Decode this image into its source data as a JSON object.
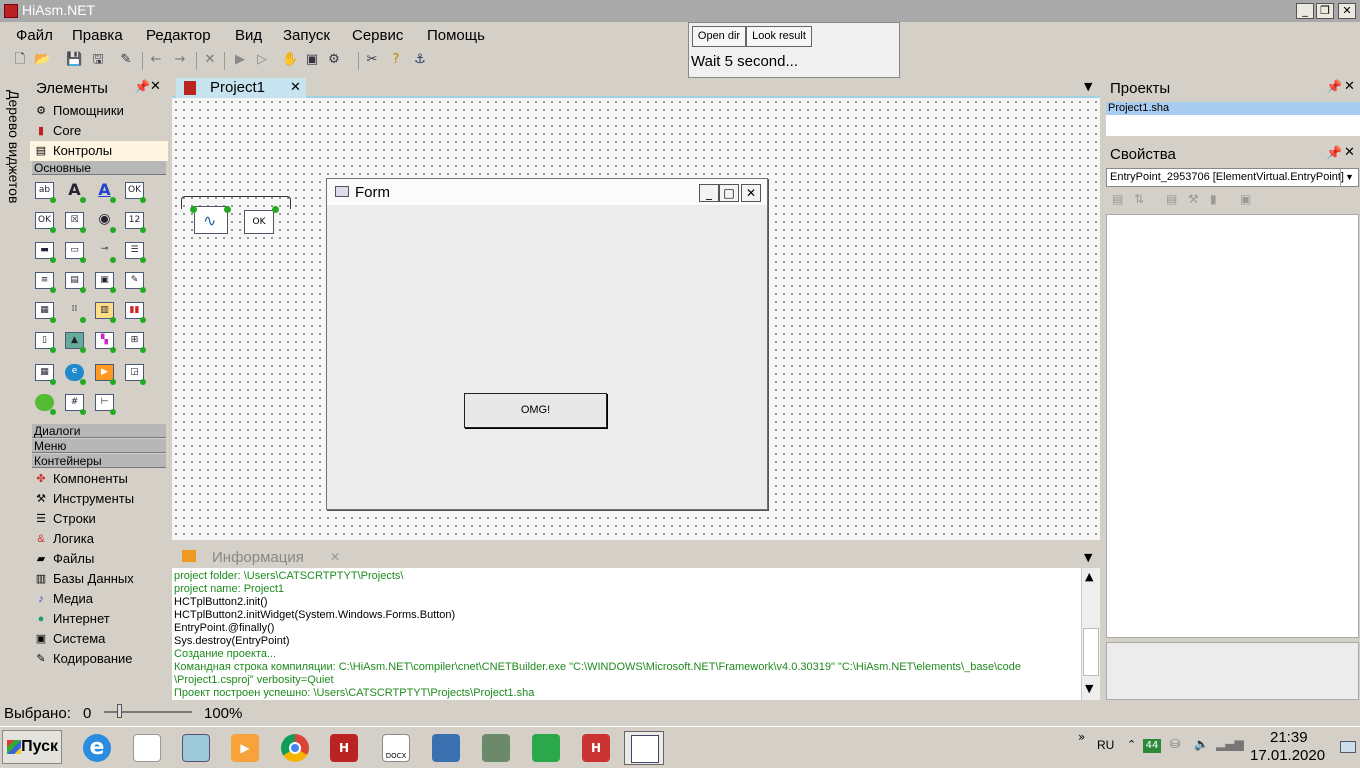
{
  "app": {
    "title": "HiAsm.NET"
  },
  "menu": [
    "Файл",
    "Правка",
    "Редактор",
    "Вид",
    "Запуск",
    "Сервис",
    "Помощь"
  ],
  "wait_panel": {
    "open_dir": "Open dir",
    "look_result": "Look result",
    "message": "Wait 5 second..."
  },
  "left": {
    "vertical_tab": "Дерево виджетов",
    "header": "Элементы",
    "top_groups": [
      "Помощники",
      "Core",
      "Контролы"
    ],
    "section_active": "Основные",
    "collapsed_sections": [
      "Диалоги",
      "Меню",
      "Контейнеры"
    ],
    "groups": [
      "Компоненты",
      "Инструменты",
      "Строки",
      "Логика",
      "Файлы",
      "Базы Данных",
      "Медиа",
      "Интернет",
      "Система",
      "Кодирование"
    ]
  },
  "doc_tab": {
    "label": "Project1"
  },
  "form": {
    "title": "Form",
    "button": "OMG!"
  },
  "info": {
    "tab": "Информация",
    "lines": [
      {
        "text": "project folder: \\Users\\CATSCRTPTYT\\Projects\\",
        "color": "#1e8a1e"
      },
      {
        "text": "project name: Project1",
        "color": "#1e8a1e"
      },
      {
        "text": "HCTplButton2.init()",
        "color": "#000000"
      },
      {
        "text": "HCTplButton2.initWidget(System.Windows.Forms.Button)",
        "color": "#000000"
      },
      {
        "text": "EntryPoint.@finally()",
        "color": "#000000"
      },
      {
        "text": "Sys.destroy(EntryPoint)",
        "color": "#000000"
      },
      {
        "text": "Создание проекта...",
        "color": "#1e8a1e"
      },
      {
        "text": "Командная строка компиляции: C:\\HiAsm.NET\\compiler\\cnet\\CNETBuilder.exe \"C:\\WINDOWS\\Microsoft.NET\\Framework\\v4.0.30319\" \"C:\\HiAsm.NET\\elements\\_base\\code",
        "color": "#1e8a1e"
      },
      {
        "text": "\\Project1.csproj\" verbosity=Quiet",
        "color": "#1e8a1e"
      },
      {
        "text": "Проект построен успешно: \\Users\\CATSCRTPTYT\\Projects\\Project1.sha",
        "color": "#1e8a1e"
      }
    ]
  },
  "projects": {
    "title": "Проекты",
    "item": "Project1.sha"
  },
  "properties": {
    "title": "Свойства",
    "selected": "EntryPoint_2953706 [ElementVirtual.EntryPoint]"
  },
  "status": {
    "selected_label": "Выбрано:",
    "selected_count": "0",
    "zoom": "100%"
  },
  "taskbar": {
    "start": "Пуск",
    "lang": "RU",
    "badge": "44",
    "time": "21:39",
    "date": "17.01.2020",
    "docx_label": "DOCX"
  }
}
